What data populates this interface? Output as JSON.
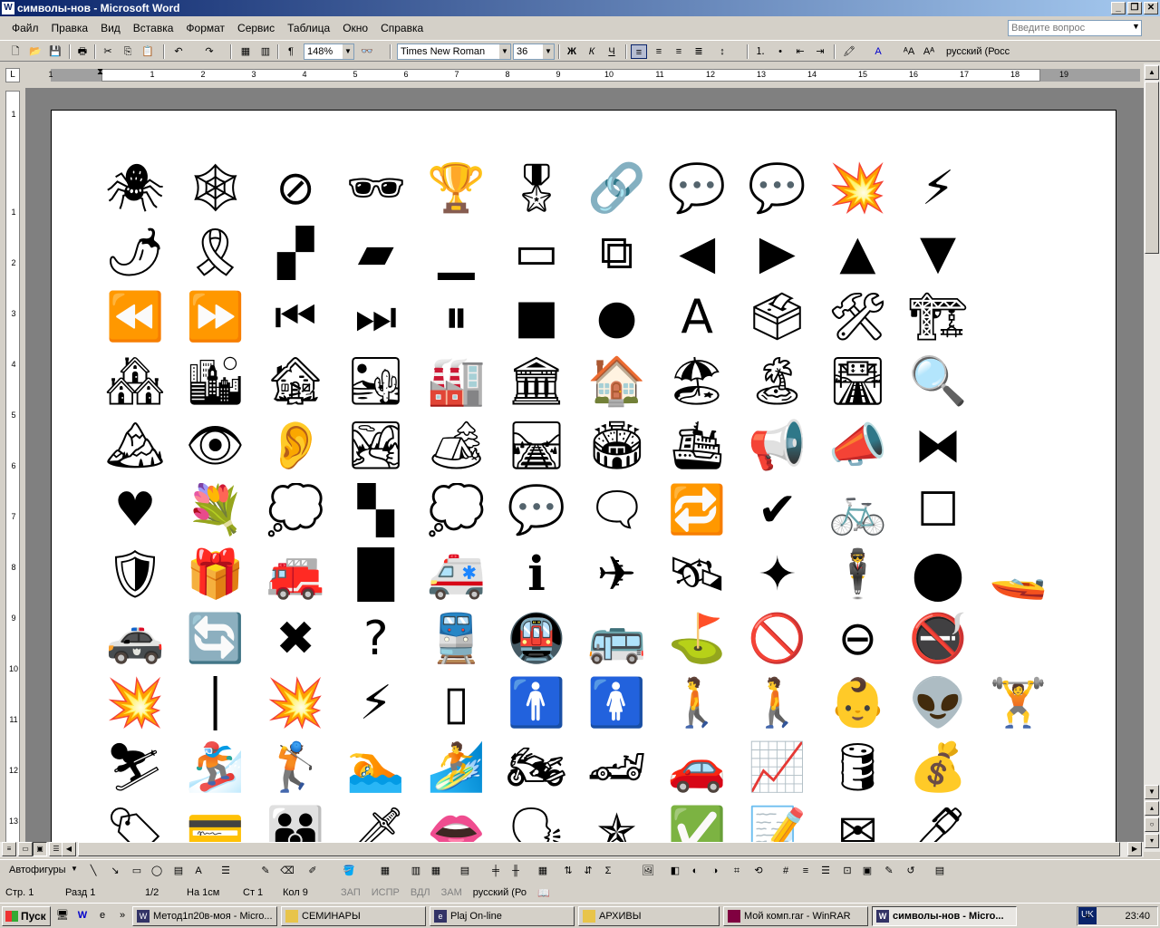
{
  "window": {
    "title": "символы-нов - Microsoft Word",
    "app_icon": "W"
  },
  "menu": [
    "Файл",
    "Правка",
    "Вид",
    "Вставка",
    "Формат",
    "Сервис",
    "Таблица",
    "Окно",
    "Справка"
  ],
  "ask_box": {
    "placeholder": "Введите вопрос"
  },
  "toolbar": {
    "zoom": "148%",
    "font": "Times New Roman",
    "size": "36",
    "bold": "Ж",
    "italic": "К",
    "underline": "Ч",
    "language": "русский (Росс"
  },
  "ruler_numbers": [
    "1",
    "1",
    "2",
    "3",
    "4",
    "5",
    "6",
    "7",
    "8",
    "9",
    "10",
    "11",
    "12",
    "13",
    "14",
    "15",
    "16",
    "17",
    "18",
    "19"
  ],
  "vruler_numbers": [
    "1",
    "1",
    "2",
    "3",
    "4",
    "5",
    "6",
    "7",
    "8",
    "9",
    "10",
    "11",
    "12",
    "13"
  ],
  "glyph_rows": [
    [
      "🕷",
      "🕸",
      "⊘",
      "🕶",
      "🏆",
      "🎖",
      "🔗",
      "💬",
      "💬",
      "💥",
      "⚡"
    ],
    [
      "🌶",
      "🎗",
      "▞",
      "▰",
      "▁",
      "▭",
      "⧉",
      "◀",
      "▶",
      "▲",
      "▼"
    ],
    [
      "⏪",
      "⏩",
      "⏮",
      "⏭",
      "⏸",
      "■",
      "●",
      "A",
      "🗳",
      "🛠",
      "🏗"
    ],
    [
      "🏘",
      "🏙",
      "🏚",
      "🏜",
      "🏭",
      "🏛",
      "🏠",
      "🏖",
      "🏝",
      "🛣",
      "🔍"
    ],
    [
      "🏔",
      "👁",
      "👂",
      "🏞",
      "🏕",
      "🛤",
      "🏟",
      "🛳",
      "📢",
      "📣",
      "⧓"
    ],
    [
      "♥",
      "💐",
      "💭",
      "▚",
      "💭",
      "💬",
      "🗨",
      "🔁",
      "✔",
      "🚲",
      "☐"
    ],
    [
      "🛡",
      "🎁",
      "🚒",
      "█",
      "🚑",
      "ℹ",
      "✈",
      "🛰",
      "✦",
      "🕴",
      "⬤",
      "🚤"
    ],
    [
      "🚓",
      "🔄",
      "✖",
      "?",
      "🚆",
      "🚇",
      "🚌",
      "⛳",
      "🚫",
      "⊖",
      "🚭"
    ],
    [
      "💥",
      "│",
      "💥",
      "⚡",
      "▯",
      "🚹",
      "🚺",
      "🚶",
      "🚶",
      "👶",
      "👽",
      "🏋"
    ],
    [
      "⛷",
      "🏂",
      "🏌",
      "🏊",
      "🏄",
      "🏍",
      "🏎",
      "🚗",
      "📈",
      "🛢",
      "💰"
    ],
    [
      "🏷",
      "💳",
      "👪",
      "🗡",
      "👄",
      "🗣",
      "✯",
      "✅",
      "📝",
      "✉",
      "🖊"
    ]
  ],
  "drawbar": {
    "autoshapes": "Автофигуры"
  },
  "status": {
    "page": "Стр. 1",
    "section": "Разд 1",
    "pages": "1/2",
    "at": "На 1см",
    "line": "Ст 1",
    "col": "Кол 9",
    "rec": "ЗАП",
    "trk": "ИСПР",
    "ext": "ВДЛ",
    "ovr": "ЗАМ",
    "lang": "русский (Ро"
  },
  "taskbar": {
    "start": "Пуск",
    "items": [
      "Метод1п20в-моя - Micro...",
      "СЕМИНАРЫ",
      "Plaj On-line",
      "АРХИВЫ",
      "Мой комп.rar - WinRAR",
      "символы-нов - Micro..."
    ],
    "lang": "UK",
    "time": "23:40"
  }
}
